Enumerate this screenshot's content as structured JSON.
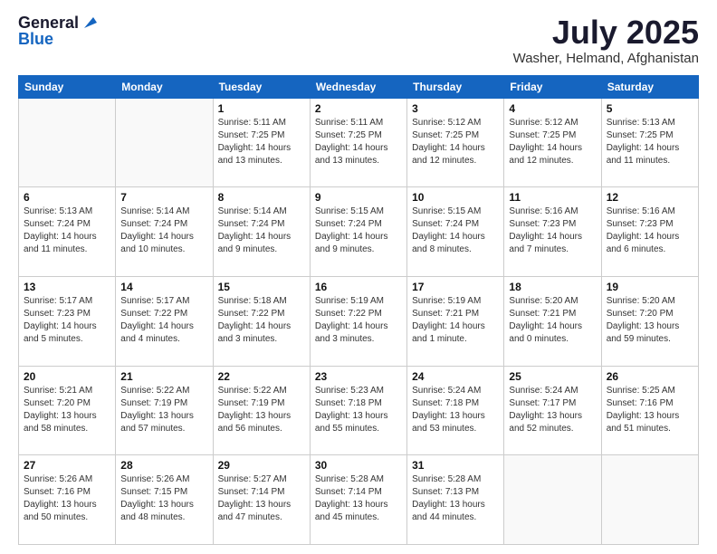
{
  "header": {
    "logo_general": "General",
    "logo_blue": "Blue",
    "month_title": "July 2025",
    "location": "Washer, Helmand, Afghanistan"
  },
  "weekdays": [
    "Sunday",
    "Monday",
    "Tuesday",
    "Wednesday",
    "Thursday",
    "Friday",
    "Saturday"
  ],
  "weeks": [
    [
      {
        "day": "",
        "info": ""
      },
      {
        "day": "",
        "info": ""
      },
      {
        "day": "1",
        "info": "Sunrise: 5:11 AM\nSunset: 7:25 PM\nDaylight: 14 hours and 13 minutes."
      },
      {
        "day": "2",
        "info": "Sunrise: 5:11 AM\nSunset: 7:25 PM\nDaylight: 14 hours and 13 minutes."
      },
      {
        "day": "3",
        "info": "Sunrise: 5:12 AM\nSunset: 7:25 PM\nDaylight: 14 hours and 12 minutes."
      },
      {
        "day": "4",
        "info": "Sunrise: 5:12 AM\nSunset: 7:25 PM\nDaylight: 14 hours and 12 minutes."
      },
      {
        "day": "5",
        "info": "Sunrise: 5:13 AM\nSunset: 7:25 PM\nDaylight: 14 hours and 11 minutes."
      }
    ],
    [
      {
        "day": "6",
        "info": "Sunrise: 5:13 AM\nSunset: 7:24 PM\nDaylight: 14 hours and 11 minutes."
      },
      {
        "day": "7",
        "info": "Sunrise: 5:14 AM\nSunset: 7:24 PM\nDaylight: 14 hours and 10 minutes."
      },
      {
        "day": "8",
        "info": "Sunrise: 5:14 AM\nSunset: 7:24 PM\nDaylight: 14 hours and 9 minutes."
      },
      {
        "day": "9",
        "info": "Sunrise: 5:15 AM\nSunset: 7:24 PM\nDaylight: 14 hours and 9 minutes."
      },
      {
        "day": "10",
        "info": "Sunrise: 5:15 AM\nSunset: 7:24 PM\nDaylight: 14 hours and 8 minutes."
      },
      {
        "day": "11",
        "info": "Sunrise: 5:16 AM\nSunset: 7:23 PM\nDaylight: 14 hours and 7 minutes."
      },
      {
        "day": "12",
        "info": "Sunrise: 5:16 AM\nSunset: 7:23 PM\nDaylight: 14 hours and 6 minutes."
      }
    ],
    [
      {
        "day": "13",
        "info": "Sunrise: 5:17 AM\nSunset: 7:23 PM\nDaylight: 14 hours and 5 minutes."
      },
      {
        "day": "14",
        "info": "Sunrise: 5:17 AM\nSunset: 7:22 PM\nDaylight: 14 hours and 4 minutes."
      },
      {
        "day": "15",
        "info": "Sunrise: 5:18 AM\nSunset: 7:22 PM\nDaylight: 14 hours and 3 minutes."
      },
      {
        "day": "16",
        "info": "Sunrise: 5:19 AM\nSunset: 7:22 PM\nDaylight: 14 hours and 3 minutes."
      },
      {
        "day": "17",
        "info": "Sunrise: 5:19 AM\nSunset: 7:21 PM\nDaylight: 14 hours and 1 minute."
      },
      {
        "day": "18",
        "info": "Sunrise: 5:20 AM\nSunset: 7:21 PM\nDaylight: 14 hours and 0 minutes."
      },
      {
        "day": "19",
        "info": "Sunrise: 5:20 AM\nSunset: 7:20 PM\nDaylight: 13 hours and 59 minutes."
      }
    ],
    [
      {
        "day": "20",
        "info": "Sunrise: 5:21 AM\nSunset: 7:20 PM\nDaylight: 13 hours and 58 minutes."
      },
      {
        "day": "21",
        "info": "Sunrise: 5:22 AM\nSunset: 7:19 PM\nDaylight: 13 hours and 57 minutes."
      },
      {
        "day": "22",
        "info": "Sunrise: 5:22 AM\nSunset: 7:19 PM\nDaylight: 13 hours and 56 minutes."
      },
      {
        "day": "23",
        "info": "Sunrise: 5:23 AM\nSunset: 7:18 PM\nDaylight: 13 hours and 55 minutes."
      },
      {
        "day": "24",
        "info": "Sunrise: 5:24 AM\nSunset: 7:18 PM\nDaylight: 13 hours and 53 minutes."
      },
      {
        "day": "25",
        "info": "Sunrise: 5:24 AM\nSunset: 7:17 PM\nDaylight: 13 hours and 52 minutes."
      },
      {
        "day": "26",
        "info": "Sunrise: 5:25 AM\nSunset: 7:16 PM\nDaylight: 13 hours and 51 minutes."
      }
    ],
    [
      {
        "day": "27",
        "info": "Sunrise: 5:26 AM\nSunset: 7:16 PM\nDaylight: 13 hours and 50 minutes."
      },
      {
        "day": "28",
        "info": "Sunrise: 5:26 AM\nSunset: 7:15 PM\nDaylight: 13 hours and 48 minutes."
      },
      {
        "day": "29",
        "info": "Sunrise: 5:27 AM\nSunset: 7:14 PM\nDaylight: 13 hours and 47 minutes."
      },
      {
        "day": "30",
        "info": "Sunrise: 5:28 AM\nSunset: 7:14 PM\nDaylight: 13 hours and 45 minutes."
      },
      {
        "day": "31",
        "info": "Sunrise: 5:28 AM\nSunset: 7:13 PM\nDaylight: 13 hours and 44 minutes."
      },
      {
        "day": "",
        "info": ""
      },
      {
        "day": "",
        "info": ""
      }
    ]
  ]
}
